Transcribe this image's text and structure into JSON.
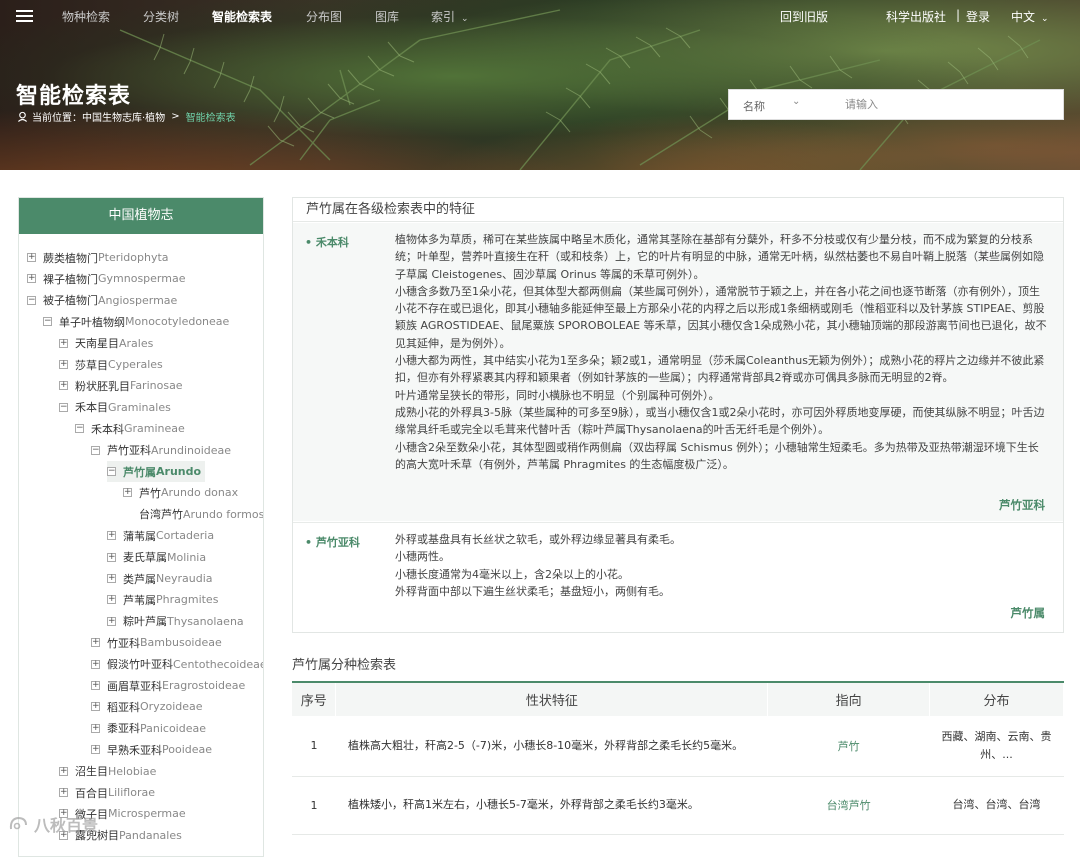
{
  "nav": {
    "items": [
      {
        "label": "物种检索",
        "active": false
      },
      {
        "label": "分类树",
        "active": false
      },
      {
        "label": "智能检索表",
        "active": true
      },
      {
        "label": "分布图",
        "active": false
      },
      {
        "label": "图库",
        "active": false
      },
      {
        "label": "索引",
        "active": false
      }
    ],
    "right": {
      "old": "回到旧版",
      "publisher": "科学出版社",
      "login": "登录",
      "lang": "中文"
    }
  },
  "page": {
    "title": "智能检索表"
  },
  "breadcrumb": {
    "prefix": "当前位置：",
    "site": "中国生物志库·植物",
    "current": "智能检索表"
  },
  "search": {
    "field": "名称",
    "placeholder": "请输入"
  },
  "sidebar": {
    "title": "中国植物志",
    "tree": [
      {
        "cn": "蕨类植物门",
        "la": "Pteridophyta",
        "toggle": "+",
        "level": 0
      },
      {
        "cn": "裸子植物门",
        "la": "Gymnospermae",
        "toggle": "+",
        "level": 0
      },
      {
        "cn": "被子植物门",
        "la": "Angiospermae",
        "toggle": "−",
        "level": 0
      },
      {
        "cn": "单子叶植物纲",
        "la": "Monocotyledoneae",
        "toggle": "−",
        "level": 1
      },
      {
        "cn": "天南星目",
        "la": "Arales",
        "toggle": "+",
        "level": 2
      },
      {
        "cn": "莎草目",
        "la": "Cyperales",
        "toggle": "+",
        "level": 2
      },
      {
        "cn": "粉状胚乳目",
        "la": "Farinosae",
        "toggle": "+",
        "level": 2
      },
      {
        "cn": "禾本目",
        "la": "Graminales",
        "toggle": "−",
        "level": 2
      },
      {
        "cn": "禾本科",
        "la": "Gramineae",
        "toggle": "−",
        "level": 3
      },
      {
        "cn": "芦竹亚科",
        "la": "Arundinoideae",
        "toggle": "−",
        "level": 4
      },
      {
        "cn": "芦竹属",
        "la": "Arundo",
        "toggle": "−",
        "level": 5,
        "selected": true
      },
      {
        "cn": "芦竹",
        "la": "Arundo donax",
        "toggle": "+",
        "level": 6
      },
      {
        "cn": "台湾芦竹",
        "la": "Arundo formosana",
        "toggle": "",
        "level": 6
      },
      {
        "cn": "蒲苇属",
        "la": "Cortaderia",
        "toggle": "+",
        "level": 5
      },
      {
        "cn": "麦氏草属",
        "la": "Molinia",
        "toggle": "+",
        "level": 5
      },
      {
        "cn": "类芦属",
        "la": "Neyraudia",
        "toggle": "+",
        "level": 5
      },
      {
        "cn": "芦苇属",
        "la": "Phragmites",
        "toggle": "+",
        "level": 5
      },
      {
        "cn": "粽叶芦属",
        "la": "Thysanolaena",
        "toggle": "+",
        "level": 5
      },
      {
        "cn": "竹亚科",
        "la": "Bambusoideae",
        "toggle": "+",
        "level": 4
      },
      {
        "cn": "假淡竹叶亚科",
        "la": "Centothecoideae",
        "toggle": "+",
        "level": 4
      },
      {
        "cn": "画眉草亚科",
        "la": "Eragrostoideae",
        "toggle": "+",
        "level": 4
      },
      {
        "cn": "稻亚科",
        "la": "Oryzoideae",
        "toggle": "+",
        "level": 4
      },
      {
        "cn": "黍亚科",
        "la": "Panicoideae",
        "toggle": "+",
        "level": 4
      },
      {
        "cn": "早熟禾亚科",
        "la": "Pooideae",
        "toggle": "+",
        "level": 4
      },
      {
        "cn": "沼生目",
        "la": "Helobiae",
        "toggle": "+",
        "level": 2
      },
      {
        "cn": "百合目",
        "la": "Liliflorae",
        "toggle": "+",
        "level": 2
      },
      {
        "cn": "微子目",
        "la": "Microspermae",
        "toggle": "+",
        "level": 2
      },
      {
        "cn": "露兜树目",
        "la": "Pandanales",
        "toggle": "+",
        "level": 2
      }
    ]
  },
  "features": {
    "title": "芦竹属在各级检索表中的特征",
    "blocks": [
      {
        "label": "禾本科",
        "lines": [
          "植物体多为草质，稀可在某些族属中略呈木质化，通常其茎除在基部有分蘖外，秆多不分枝或仅有少量分枝，而不成为繁复的分枝系统；叶单型，营养叶直接生在秆（或和枝条）上，它的叶片有明显的中脉，通常无叶柄，纵然枯萎也不易自叶鞘上脱落（某些属例如隐子草属 Cleistogenes、固沙草属 Orinus 等属的禾草可例外）。",
          "小穗含多数乃至1朵小花，但其体型大都两侧扁（某些属可例外），通常脱节于颖之上，并在各小花之间也逐节断落（亦有例外），顶生小花不存在或已退化，即其小穗轴多能延伸至最上方那朵小花的内稃之后以形成1条细柄或刚毛（惟稻亚科以及针茅族 STIPEAE、剪股颖族 AGROSTIDEAE、鼠尾粟族 SPOROBOLEAE 等禾草，因其小穗仅含1朵成熟小花，其小穗轴顶端的那段游离节间也已退化，故不见其延伸，是为例外）。",
          "小穗大都为两性，其中结实小花为1至多朵；颖2或1，通常明显（莎禾属Coleanthus无颖为例外）；成熟小花的稃片之边缘并不彼此紧扣，但亦有外稃紧裹其内稃和颖果者（例如针茅族的一些属）；内稃通常背部具2脊或亦可偶具多脉而无明显的2脊。",
          "叶片通常呈狭长的带形，同时小横脉也不明显（个别属种可例外）。",
          "成熟小花的外稃具3-5脉（某些属种的可多至9脉），或当小穗仅含1或2朵小花时，亦可因外稃质地变厚硬，而使其纵脉不明显；叶舌边缘常具纤毛或完全以毛茸来代替叶舌（粽叶芦属Thysanolaena的叶舌无纤毛是个例外）。",
          "小穗含2朵至数朵小花，其体型圆或稍作两侧扁（双齿稃属 Schismus 例外）；小穗轴常生短柔毛。多为热带及亚热带潮湿环境下生长的高大宽叶禾草（有例外，芦苇属 Phragmites 的生态幅度极广泛）。"
        ],
        "next": "芦竹亚科"
      },
      {
        "label": "芦竹亚科",
        "lines": [
          "外稃或基盘具有长丝状之软毛，或外稃边缘显著具有柔毛。",
          "小穗两性。",
          "小穗长度通常为4毫米以上，含2朵以上的小花。",
          "外稃背面中部以下遍生丝状柔毛；基盘短小，两侧有毛。"
        ],
        "next": "芦竹属"
      }
    ]
  },
  "key_table": {
    "title": "芦竹属分种检索表",
    "headers": [
      "序号",
      "性状特征",
      "指向",
      "分布"
    ],
    "rows": [
      {
        "no": "1",
        "desc": "植株高大粗壮，秆高2-5（-7)米，小穗长8-10毫米，外稃背部之柔毛长约5毫米。",
        "target": "芦竹",
        "dist": "西藏、湖南、云南、贵州、..."
      },
      {
        "no": "1",
        "desc": "植株矮小，秆高1米左右，小穗长5-7毫米，外稃背部之柔毛长约3毫米。",
        "target": "台湾芦竹",
        "dist": "台湾、台湾、台湾"
      }
    ]
  },
  "watermark": "八秋百景",
  "colors": {
    "accent": "#4b8a6a",
    "header_bg": "#2f3a2a"
  }
}
